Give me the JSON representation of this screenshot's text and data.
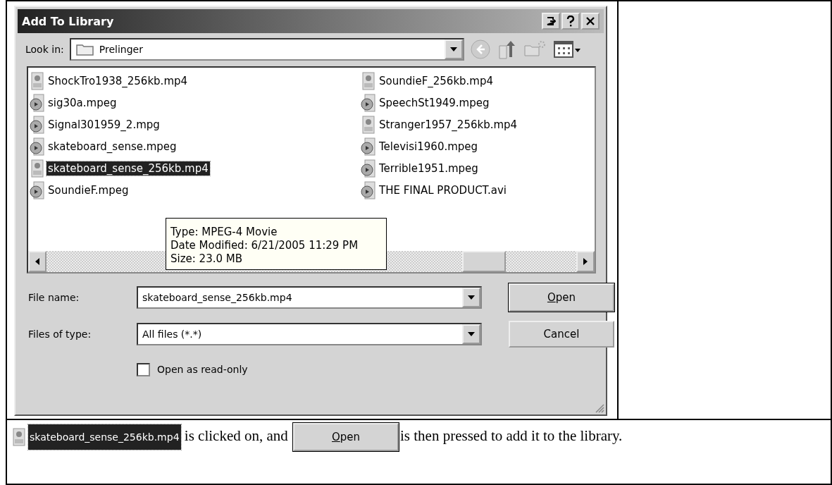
{
  "dialog": {
    "title": "Add To Library",
    "look_in": {
      "label": "Look in:",
      "value": "Prelinger"
    },
    "files": [
      {
        "name": "ShockTro1938_256kb.mp4",
        "kind": "mp4",
        "selected": false
      },
      {
        "name": "sig30a.mpeg",
        "kind": "mpeg",
        "selected": false
      },
      {
        "name": "Signal301959_2.mpg",
        "kind": "mpeg",
        "selected": false
      },
      {
        "name": "skateboard_sense.mpeg",
        "kind": "mpeg",
        "selected": false
      },
      {
        "name": "skateboard_sense_256kb.mp4",
        "kind": "mp4",
        "selected": true
      },
      {
        "name": "SoundieF.mpeg",
        "kind": "mpeg",
        "selected": false
      },
      {
        "name": "SoundieF_256kb.mp4",
        "kind": "mp4",
        "selected": false
      },
      {
        "name": "SpeechSt1949.mpeg",
        "kind": "mpeg",
        "selected": false
      },
      {
        "name": "Stranger1957_256kb.mp4",
        "kind": "mp4",
        "selected": false
      },
      {
        "name": "Televisi1960.mpeg",
        "kind": "mpeg",
        "selected": false
      },
      {
        "name": "Terrible1951.mpeg",
        "kind": "mpeg",
        "selected": false
      },
      {
        "name": "THE FINAL PRODUCT.avi",
        "kind": "mpeg",
        "selected": false
      }
    ],
    "tooltip": [
      "Type: MPEG-4 Movie",
      "Date Modified: 6/21/2005 11:29 PM",
      "Size: 23.0 MB"
    ],
    "file_name": {
      "label": "File name:",
      "value": "skateboard_sense_256kb.mp4"
    },
    "file_type": {
      "label": "Files of type:",
      "value": "All files (*.*)"
    },
    "read_only": {
      "label": "Open as read-only",
      "checked": false
    },
    "buttons": [
      "Open",
      "Cancel"
    ]
  },
  "caption": {
    "item": "skateboard_sense_256kb.mp4",
    "text_1": "is clicked on, and",
    "button": "Open",
    "text_2": "is then pressed to add it to the library."
  }
}
